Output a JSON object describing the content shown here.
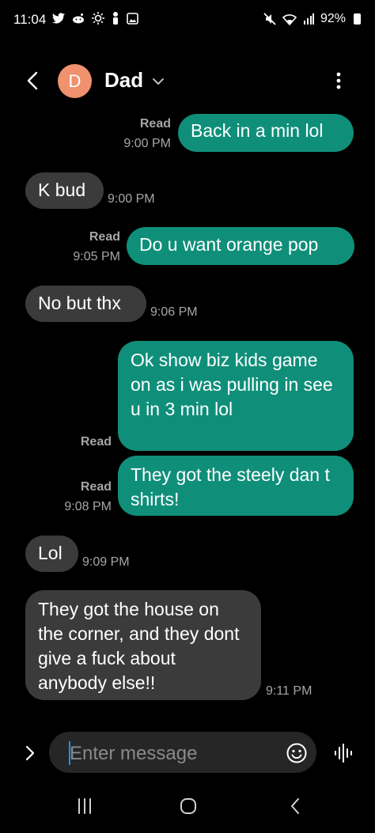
{
  "status_bar": {
    "time": "11:04",
    "battery": "92%",
    "left_icons": [
      "twitter-icon",
      "reddit-icon",
      "brightness-icon",
      "person-icon",
      "image-icon"
    ],
    "right_icons": [
      "mute-icon",
      "wifi-icon",
      "signal-icon",
      "battery-icon"
    ]
  },
  "header": {
    "avatar_letter": "D",
    "contact_name": "Dad"
  },
  "messages": [
    {
      "direction": "out",
      "text": "Back in a min lol",
      "read": "Read",
      "time": "9:00 PM"
    },
    {
      "direction": "in",
      "text": "K bud",
      "time": "9:00 PM"
    },
    {
      "direction": "out",
      "text": "Do u want orange pop",
      "read": "Read",
      "time": "9:05 PM"
    },
    {
      "direction": "in",
      "text": "No but thx",
      "time": "9:06 PM"
    },
    {
      "direction": "out",
      "text": "Ok show biz kids game on as i was pulling in see u in 3 min lol",
      "read": "Read"
    },
    {
      "direction": "out",
      "text": "They got the steely dan t shirts!",
      "read": "Read",
      "time": "9:08 PM"
    },
    {
      "direction": "in",
      "text": "Lol",
      "time": "9:09 PM"
    },
    {
      "direction": "in",
      "text": "They got the house on the corner, and they dont give a fuck about anybody else!!",
      "time": "9:11 PM"
    }
  ],
  "composer": {
    "placeholder": "Enter message"
  },
  "colors": {
    "outgoing_bubble": "#0f8f7a",
    "incoming_bubble": "#3b3b3b",
    "avatar": "#f0926d",
    "background": "#000000"
  }
}
